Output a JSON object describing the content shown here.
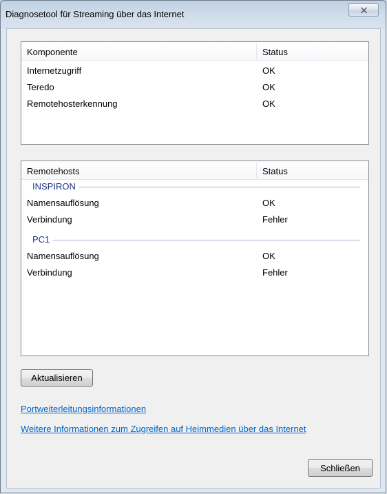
{
  "window": {
    "title": "Diagnosetool für Streaming über das Internet"
  },
  "components_list": {
    "header": {
      "name": "Komponente",
      "status": "Status"
    },
    "rows": [
      {
        "name": "Internetzugriff",
        "status": "OK"
      },
      {
        "name": "Teredo",
        "status": "OK"
      },
      {
        "name": "Remotehosterkennung",
        "status": "OK"
      }
    ]
  },
  "remotehosts_list": {
    "header": {
      "name": "Remotehosts",
      "status": "Status"
    },
    "groups": [
      {
        "name": "INSPIRON",
        "rows": [
          {
            "name": "Namensauflösung",
            "status": "OK"
          },
          {
            "name": "Verbindung",
            "status": "Fehler"
          }
        ]
      },
      {
        "name": "PC1",
        "rows": [
          {
            "name": "Namensauflösung",
            "status": "OK"
          },
          {
            "name": "Verbindung",
            "status": "Fehler"
          }
        ]
      }
    ]
  },
  "buttons": {
    "refresh": "Aktualisieren",
    "close": "Schließen"
  },
  "links": {
    "port_forwarding": "Portweiterleitungsinformationen",
    "more_info": "Weitere Informationen zum Zugreifen auf Heimmedien über das Internet"
  },
  "icons": {
    "close": "close-icon"
  },
  "colors": {
    "link": "#0066cc",
    "group_header": "#1e3287"
  }
}
